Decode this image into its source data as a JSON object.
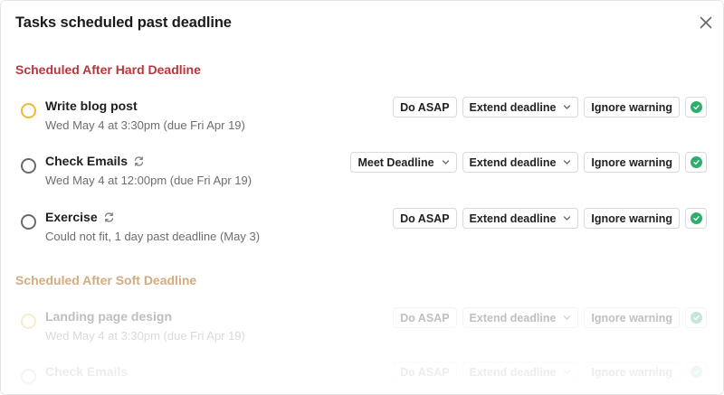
{
  "dialog": {
    "title": "Tasks scheduled past deadline",
    "close_icon": "close-icon"
  },
  "colors": {
    "hard_section": "#b8363c",
    "soft_section": "#d3a87a",
    "check_green": "#2fae6b",
    "circle_yellow": "#f0b93a",
    "circle_gray": "#6b6b6b"
  },
  "sections": {
    "hard": {
      "title": "Scheduled After Hard Deadline",
      "tasks": [
        {
          "name": "Write blog post",
          "subtitle": "Wed May 4 at 3:30pm (due Fri Apr 19)",
          "circle": "yellow",
          "repeat": false,
          "primary_action": "Do ASAP",
          "primary_dropdown": false,
          "extend_label": "Extend deadline",
          "ignore_label": "Ignore warning"
        },
        {
          "name": "Check Emails",
          "subtitle": "Wed May 4 at 12:00pm (due Fri Apr 19)",
          "circle": "gray",
          "repeat": true,
          "primary_action": "Meet Deadline",
          "primary_dropdown": true,
          "extend_label": "Extend deadline",
          "ignore_label": "Ignore warning"
        },
        {
          "name": "Exercise",
          "subtitle": "Could not fit, 1 day past deadline (May 3)",
          "circle": "gray",
          "repeat": true,
          "primary_action": "Do ASAP",
          "primary_dropdown": false,
          "extend_label": "Extend deadline",
          "ignore_label": "Ignore warning"
        }
      ]
    },
    "soft": {
      "title": "Scheduled After Soft Deadline",
      "tasks": [
        {
          "name": "Landing page design",
          "subtitle": "Wed May 4 at 3:30pm (due Fri Apr 19)",
          "circle": "yellow",
          "repeat": false,
          "primary_action": "Do ASAP",
          "primary_dropdown": false,
          "extend_label": "Extend deadline",
          "ignore_label": "Ignore warning"
        },
        {
          "name": "Check Emails",
          "subtitle": "",
          "circle": "gray",
          "repeat": false,
          "primary_action": "Do ASAP",
          "primary_dropdown": false,
          "extend_label": "Extend deadline",
          "ignore_label": "Ignore warning"
        }
      ]
    }
  }
}
